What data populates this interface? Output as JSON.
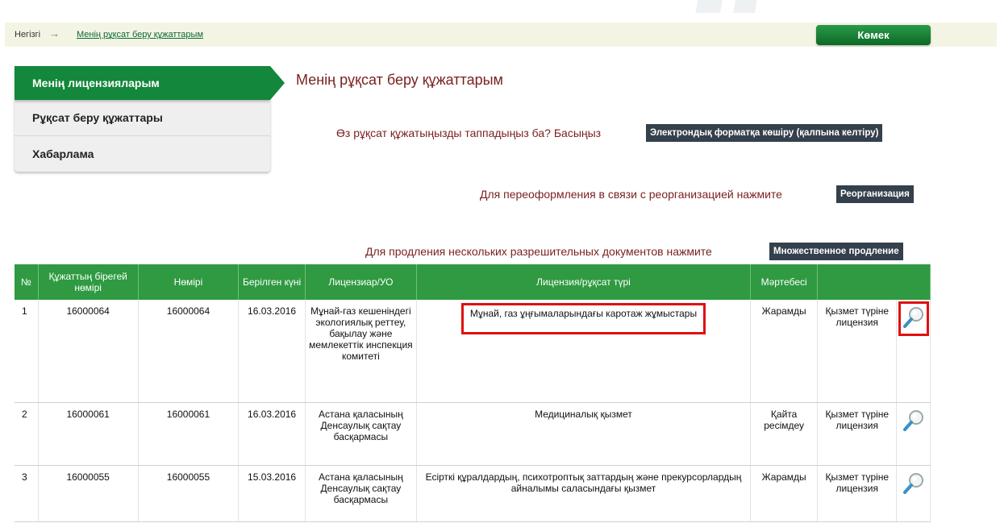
{
  "breadcrumb": {
    "home": "Негізгі",
    "arrow": "→",
    "current": "Менің рұқсат беру құжаттарым"
  },
  "help_button": "Көмек",
  "sidebar": {
    "active": "Менің лицензияларым",
    "items": [
      {
        "label": "Рұқсат беру құжаттары"
      },
      {
        "label": "Хабарлама"
      }
    ]
  },
  "page_title": "Менің рұқсат беру құжаттарым",
  "prompts": {
    "convert_text": "Өз рұқсат құжатыңызды таппадыңыз ба? Басыңыз",
    "convert_button": "Электрондық форматқа көшіру (қалпына келтіру)",
    "reorg_text": "Для переоформления в связи с реорганизацией нажмите",
    "reorg_button": "Реорганизация",
    "renew_text": "Для продления нескольких разрешительных документов нажмите",
    "renew_button": "Множественное продление"
  },
  "table": {
    "headers": [
      "№",
      "Құжаттың бірегей нөмірі",
      "Нөмірі",
      "Берілген күні",
      "Лицензиар/УО",
      "Лицензия/рұқсат түрі",
      "Мәртебесі",
      ""
    ],
    "rows": [
      {
        "n": "1",
        "uid": "16000064",
        "number": "16000064",
        "date": "16.03.2016",
        "licensor": "Мұнай-газ кешеніндегі экологиялық реттеу, бақылау және мемлекеттік инспекция комитеті",
        "type": "Мұнай, газ ұңғымаларындағы каротаж жұмыстары",
        "status": "Жарамды",
        "kind": "Қызмет түріне лицензия"
      },
      {
        "n": "2",
        "uid": "16000061",
        "number": "16000061",
        "date": "16.03.2016",
        "licensor": "Астана қаласының Денсаулық сақтау басқармасы",
        "type": "Медициналық қызмет",
        "status": "Қайта ресімдеу",
        "kind": "Қызмет түріне лицензия"
      },
      {
        "n": "3",
        "uid": "16000055",
        "number": "16000055",
        "date": "15.03.2016",
        "licensor": "Астана қаласының Денсаулық сақтау басқармасы",
        "type": "Есірткі құралдардың, психотроптық заттардың және прекурсорлардың айналымы саласындағы қызмет",
        "status": "Жарамды",
        "kind": "Қызмет түріне лицензия"
      }
    ]
  },
  "icons": {
    "view": "magnifier-icon"
  },
  "colors": {
    "green": "#2f9a41",
    "nav_green": "#13873b",
    "highlight": "#e01010",
    "title_red": "#7a1f1f",
    "dark_button": "#34404c"
  }
}
